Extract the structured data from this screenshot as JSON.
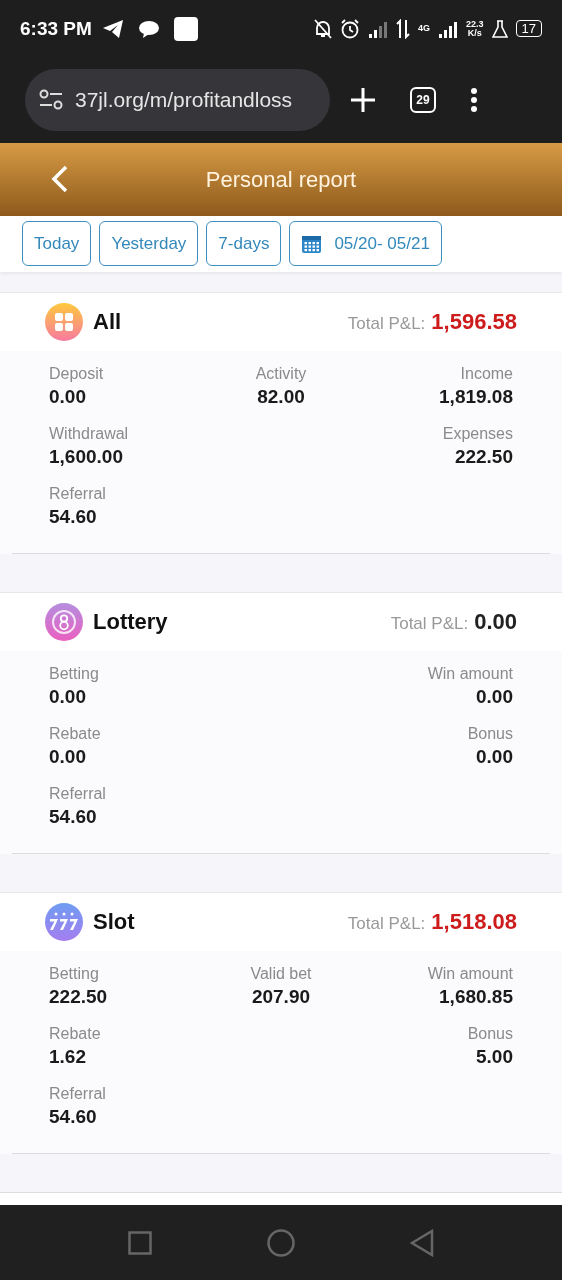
{
  "status_bar": {
    "time": "6:33 PM",
    "network": "4G",
    "speed": "22.3",
    "speed_unit": "K/s",
    "battery": "17"
  },
  "browser": {
    "url": "37jl.org/m/profitandloss",
    "tab_count": "29"
  },
  "header": {
    "title": "Personal report"
  },
  "filters": [
    {
      "kind": "text",
      "label": "Today"
    },
    {
      "kind": "text",
      "label": "Yesterday"
    },
    {
      "kind": "text",
      "label": "7-days"
    },
    {
      "kind": "date",
      "label": "05/20- 05/21"
    }
  ],
  "cards": [
    {
      "kind": "grid",
      "title": "All",
      "pnl_label": "Total P&L:",
      "pnl_value": "1,596.58",
      "highlighted": true,
      "rows": [
        {
          "left": {
            "label": "Deposit",
            "value": "0.00"
          },
          "middle": {
            "label": "Activity",
            "value": "82.00"
          },
          "right": {
            "label": "Income",
            "value": "1,819.08"
          }
        },
        {
          "left": {
            "label": "Withdrawal",
            "value": "1,600.00"
          },
          "right": {
            "label": "Expenses",
            "value": "222.50"
          }
        },
        {
          "left": {
            "label": "Referral",
            "value": "54.60"
          }
        }
      ]
    },
    {
      "kind": "ball",
      "title": "Lottery",
      "pnl_label": "Total P&L:",
      "pnl_value": "0.00",
      "highlighted": false,
      "rows": [
        {
          "left": {
            "label": "Betting",
            "value": "0.00"
          },
          "right": {
            "label": "Win amount",
            "value": "0.00"
          }
        },
        {
          "left": {
            "label": "Rebate",
            "value": "0.00"
          },
          "right": {
            "label": "Bonus",
            "value": "0.00"
          }
        },
        {
          "left": {
            "label": "Referral",
            "value": "54.60"
          }
        }
      ]
    },
    {
      "kind": "slot",
      "title": "Slot",
      "pnl_label": "Total P&L:",
      "pnl_value": "1,518.08",
      "highlighted": true,
      "rows": [
        {
          "left": {
            "label": "Betting",
            "value": "222.50"
          },
          "middle": {
            "label": "Valid bet",
            "value": "207.90"
          },
          "right": {
            "label": "Win amount",
            "value": "1,680.85"
          }
        },
        {
          "left": {
            "label": "Rebate",
            "value": "1.62"
          },
          "right": {
            "label": "Bonus",
            "value": "5.00"
          }
        },
        {
          "left": {
            "label": "Referral",
            "value": "54.60"
          }
        }
      ]
    }
  ]
}
